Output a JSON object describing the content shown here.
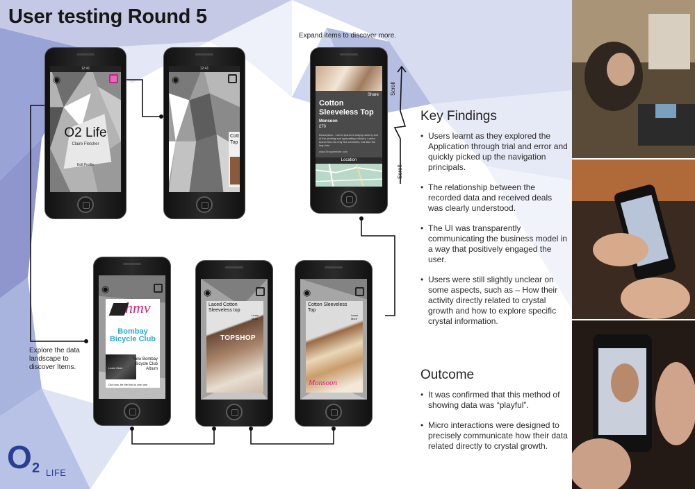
{
  "title": "User testing Round 5",
  "captions": {
    "expand": "Expand items to discover more.",
    "explore": "Explore the data landscape to discover Items.",
    "scroll": "Scroll"
  },
  "phones": {
    "profile": {
      "status": "12:41",
      "title": "O2 Life",
      "name": "Claire Fletcher",
      "edit": "Edit Profile"
    },
    "partial": {
      "peek_title": "Cott",
      "peek_sub": "Top"
    },
    "detail": {
      "share": "Share",
      "item_title": "Cotton Sleeveless Top",
      "brand": "Monsoon",
      "price": "£70",
      "description": "Description - Lorem Ipsum is simply dummy text of the printing and typesetting industry. Lorem Ipsum has not only five centuries, but also the leap into",
      "url": "www.Shopwebsite.com",
      "location": "Location"
    },
    "hmv": {
      "brand": "hmv",
      "band": "Bombay Bicycle Club",
      "album": "New Bombay Bicycle Club Album",
      "learn": "Learn More",
      "footer": "Out now, be the first to own one"
    },
    "topshop": {
      "item": "Laced Cotton Sleeveless top",
      "brand": "TOPSHOP",
      "learn": "Learn More"
    },
    "monsoon": {
      "item": "Cotton Sleeveless Top",
      "brand": "Monsoon",
      "learn": "Learn More"
    }
  },
  "key_findings": {
    "heading": "Key Findings",
    "items": [
      "Users learnt as they explored the Application through trial and error and quickly picked up the navigation principals.",
      "The relationship between the recorded data and received deals was clearly understood.",
      "The UI was transparently communicating the business model in a way that positively engaged the user.",
      "Users were still slightly unclear on some aspects, such as – How their activity directly related to crystal growth and how to explore specific crystal information."
    ]
  },
  "outcome": {
    "heading": "Outcome",
    "items": [
      "It was confirmed that this method of showing data was “playful”.",
      "Micro interactions were designed to precisely communicate how their data related directly to crystal growth."
    ]
  },
  "logo": {
    "o": "O",
    "two": "2",
    "life": "LIFE"
  },
  "colors": {
    "logo": "#2b3e93",
    "accent_pink": "#d6247a",
    "band_blue": "#2fa6d6"
  },
  "icons": [
    "eye-icon",
    "squares-icon",
    "home-button-icon"
  ]
}
